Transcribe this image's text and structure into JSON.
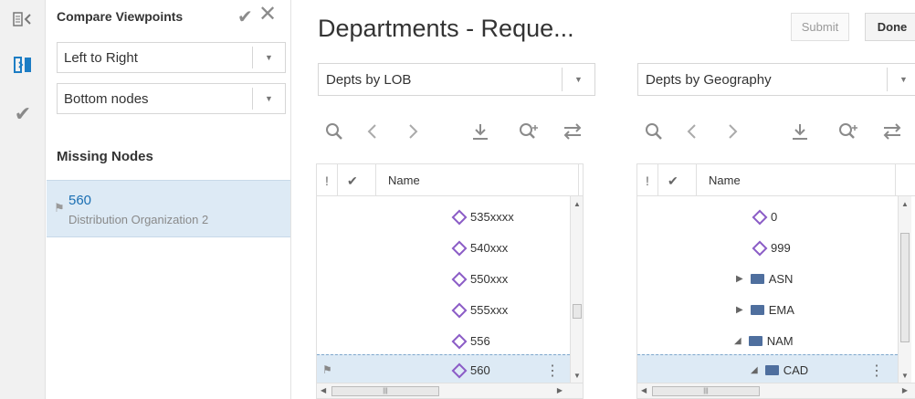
{
  "title": "Departments - Reque...",
  "buttons": {
    "submit": "Submit",
    "done": "Done"
  },
  "compare": {
    "title": "Compare Viewpoints",
    "direction": "Left to Right",
    "scope": "Bottom nodes",
    "missing_heading": "Missing Nodes",
    "missing_items": [
      {
        "code": "560",
        "description": "Distribution Organization 2"
      }
    ]
  },
  "left_viewpoint": {
    "name": "Depts by LOB",
    "columns": {
      "flag": "!",
      "check": "✔",
      "name": "Name"
    },
    "rows": [
      "535xxxx",
      "540xxx",
      "550xxx",
      "555xxx",
      "556",
      "560"
    ]
  },
  "right_viewpoint": {
    "name": "Depts by Geography",
    "columns": {
      "flag": "!",
      "check": "✔",
      "name": "Name"
    },
    "rows": [
      "0",
      "999",
      "ASN",
      "EMA",
      "NAM",
      "CAD"
    ]
  },
  "icons": [
    "panel-collapse-icon",
    "compare-icon",
    "validate-icon",
    "search-icon",
    "back-icon",
    "forward-icon",
    "download-icon",
    "zoom-add-icon",
    "swap-icon",
    "flag-icon",
    "diamond-node-icon",
    "folder-icon",
    "kebab-icon"
  ]
}
